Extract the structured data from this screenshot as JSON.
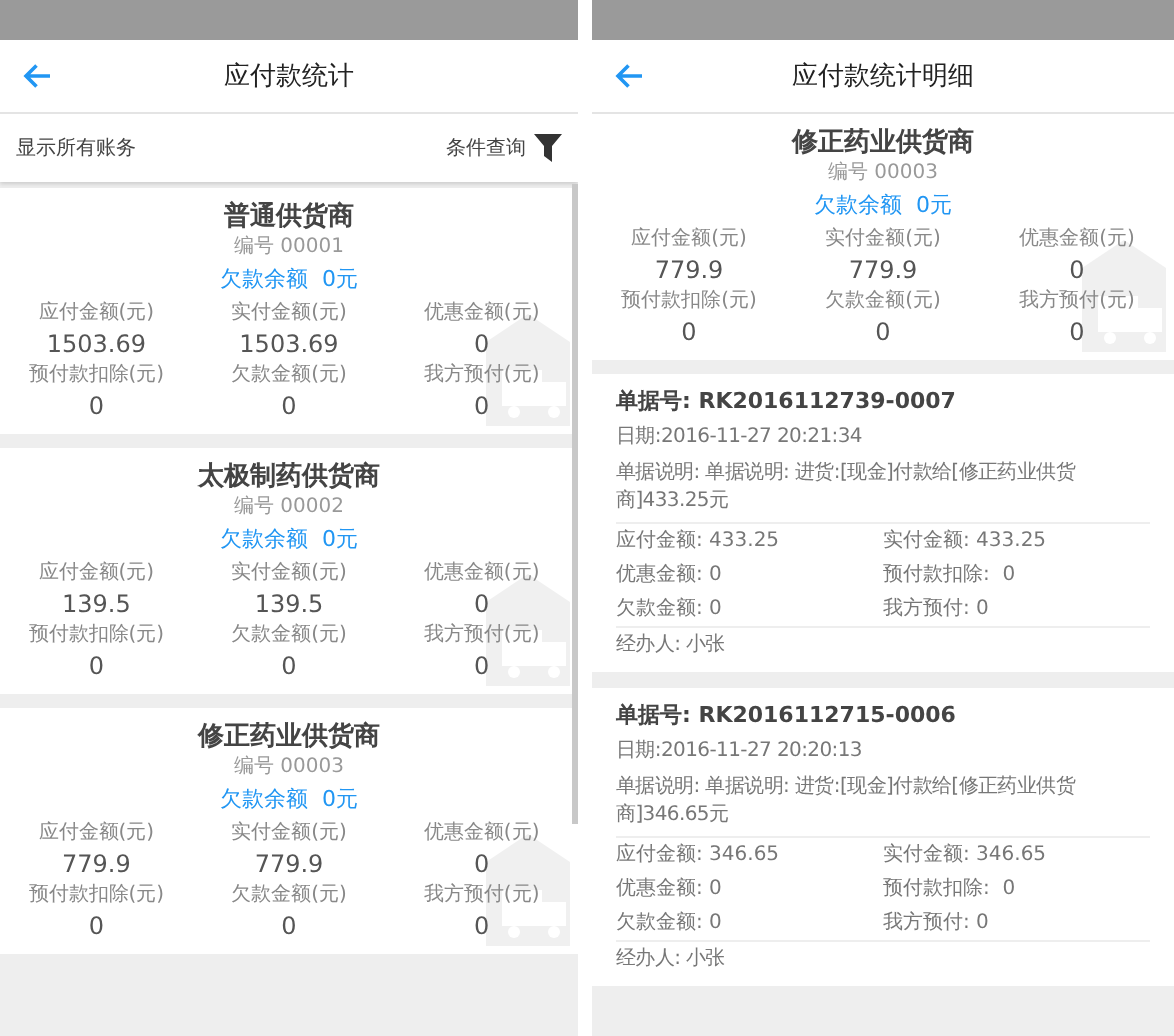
{
  "list_screen": {
    "title": "应付款统计",
    "filter_bar": {
      "show_all": "显示所有账务",
      "query": "条件查询"
    },
    "suppliers": [
      {
        "name": "普通供货商",
        "code": "编号 00001",
        "balance": "欠款余额  0元",
        "stats": [
          {
            "label": "应付金额(元)",
            "value": "1503.69"
          },
          {
            "label": "实付金额(元)",
            "value": "1503.69"
          },
          {
            "label": "优惠金额(元)",
            "value": "0"
          },
          {
            "label": "预付款扣除(元)",
            "value": "0"
          },
          {
            "label": "欠款金额(元)",
            "value": "0"
          },
          {
            "label": "我方预付(元)",
            "value": "0"
          }
        ]
      },
      {
        "name": "太极制药供货商",
        "code": "编号 00002",
        "balance": "欠款余额  0元",
        "stats": [
          {
            "label": "应付金额(元)",
            "value": "139.5"
          },
          {
            "label": "实付金额(元)",
            "value": "139.5"
          },
          {
            "label": "优惠金额(元)",
            "value": "0"
          },
          {
            "label": "预付款扣除(元)",
            "value": "0"
          },
          {
            "label": "欠款金额(元)",
            "value": "0"
          },
          {
            "label": "我方预付(元)",
            "value": "0"
          }
        ]
      },
      {
        "name": "修正药业供货商",
        "code": "编号 00003",
        "balance": "欠款余额  0元",
        "stats": [
          {
            "label": "应付金额(元)",
            "value": "779.9"
          },
          {
            "label": "实付金额(元)",
            "value": "779.9"
          },
          {
            "label": "优惠金额(元)",
            "value": "0"
          },
          {
            "label": "预付款扣除(元)",
            "value": "0"
          },
          {
            "label": "欠款金额(元)",
            "value": "0"
          },
          {
            "label": "我方预付(元)",
            "value": "0"
          }
        ]
      }
    ]
  },
  "detail_screen": {
    "title": "应付款统计明细",
    "supplier": {
      "name": "修正药业供货商",
      "code": "编号 00003",
      "balance": "欠款余额  0元",
      "stats": [
        {
          "label": "应付金额(元)",
          "value": "779.9"
        },
        {
          "label": "实付金额(元)",
          "value": "779.9"
        },
        {
          "label": "优惠金额(元)",
          "value": "0"
        },
        {
          "label": "预付款扣除(元)",
          "value": "0"
        },
        {
          "label": "欠款金额(元)",
          "value": "0"
        },
        {
          "label": "我方预付(元)",
          "value": "0"
        }
      ]
    },
    "records": [
      {
        "number": "单据号: RK2016112739-0007",
        "date": "日期:2016-11-27 20:21:34",
        "description": "单据说明: 单据说明: 进货:[现金]付款给[修正药业供货商]433.25元",
        "fields": [
          "应付金额: 433.25",
          "实付金额: 433.25",
          "优惠金额: 0",
          "预付款扣除:  0",
          "欠款金额: 0",
          "我方预付: 0"
        ],
        "handler": "经办人: 小张"
      },
      {
        "number": "单据号: RK2016112715-0006",
        "date": "日期:2016-11-27 20:20:13",
        "description": "单据说明: 单据说明: 进货:[现金]付款给[修正药业供货商]346.65元",
        "fields": [
          "应付金额: 346.65",
          "实付金额: 346.65",
          "优惠金额: 0",
          "预付款扣除:  0",
          "欠款金额: 0",
          "我方预付: 0"
        ],
        "handler": "经办人: 小张"
      }
    ]
  }
}
